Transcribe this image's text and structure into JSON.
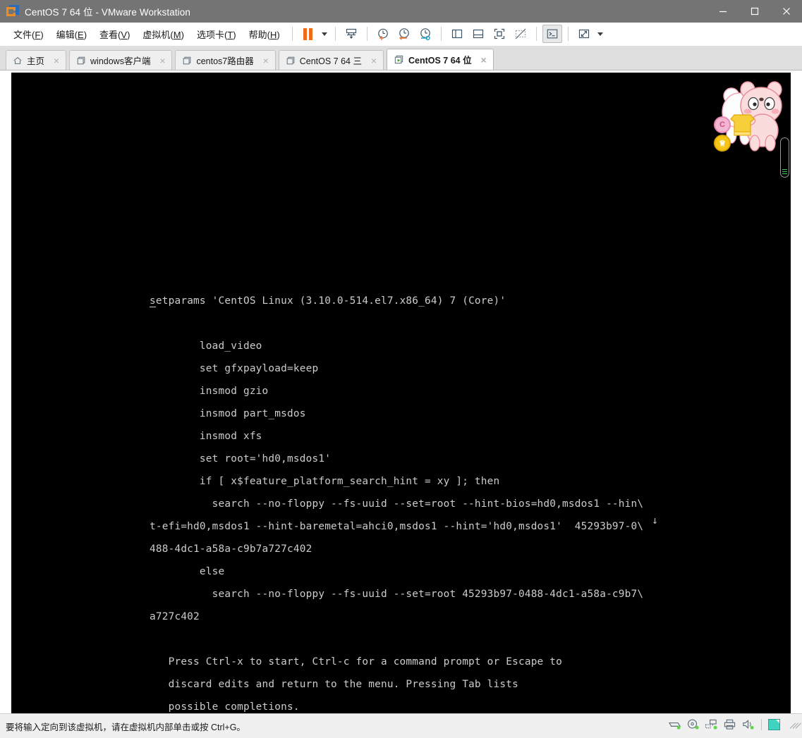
{
  "window": {
    "title": "CentOS 7 64 位 - VMware Workstation",
    "app_icon": "vmware-logo-icon",
    "controls": {
      "minimize": "minimize-icon",
      "maximize": "maximize-icon",
      "close": "close-icon"
    }
  },
  "menu": {
    "items": [
      {
        "label": "文件",
        "mnemonic": "F"
      },
      {
        "label": "编辑",
        "mnemonic": "E"
      },
      {
        "label": "查看",
        "mnemonic": "V"
      },
      {
        "label": "虚拟机",
        "mnemonic": "M"
      },
      {
        "label": "选项卡",
        "mnemonic": "T"
      },
      {
        "label": "帮助",
        "mnemonic": "H"
      }
    ]
  },
  "toolbar": {
    "buttons": [
      {
        "name": "pause-vm-button",
        "icon": "pause-icon"
      },
      {
        "name": "pause-dropdown-button",
        "icon": "chevron-down-icon"
      },
      {
        "name": "send-ctrl-alt-del-button",
        "icon": "keyboard-send-icon"
      },
      {
        "name": "take-snapshot-button",
        "icon": "snapshot-add-icon"
      },
      {
        "name": "revert-snapshot-button",
        "icon": "snapshot-revert-icon"
      },
      {
        "name": "snapshot-manager-button",
        "icon": "snapshot-manager-icon"
      },
      {
        "name": "show-left-pane-button",
        "icon": "pane-left-icon"
      },
      {
        "name": "show-bottom-pane-button",
        "icon": "pane-bottom-icon"
      },
      {
        "name": "full-screen-button",
        "icon": "fullscreen-icon"
      },
      {
        "name": "unity-mode-button",
        "icon": "unity-mode-icon"
      },
      {
        "name": "console-view-button",
        "icon": "console-prompt-icon",
        "pressed": true
      },
      {
        "name": "stretch-view-button",
        "icon": "stretch-arrows-icon"
      },
      {
        "name": "stretch-dropdown-button",
        "icon": "chevron-down-icon"
      }
    ]
  },
  "tabs": [
    {
      "label": "主页",
      "icon": "home-icon",
      "active": false,
      "closable": true
    },
    {
      "label": "windows客户端",
      "icon": "vm-screen-icon",
      "active": false,
      "closable": true
    },
    {
      "label": "centos7路由器",
      "icon": "vm-screen-icon",
      "active": false,
      "closable": true
    },
    {
      "label": "CentOS 7 64 三",
      "icon": "vm-screen-icon",
      "active": false,
      "closable": true
    },
    {
      "label": "CentOS 7 64 位",
      "icon": "vm-screen-running-icon",
      "active": true,
      "closable": true
    }
  ],
  "vm_console": {
    "background_color": "#000000",
    "text_color": "#cccccc",
    "cursor_on_char": "s",
    "lines": [
      "setparams 'CentOS Linux (3.10.0-514.el7.x86_64) 7 (Core)'",
      "",
      "        load_video",
      "        set gfxpayload=keep",
      "        insmod gzio",
      "        insmod part_msdos",
      "        insmod xfs",
      "        set root='hd0,msdos1'",
      "        if [ x$feature_platform_search_hint = xy ]; then",
      "          search --no-floppy --fs-uuid --set=root --hint-bios=hd0,msdos1 --hin\\",
      "t-efi=hd0,msdos1 --hint-baremetal=ahci0,msdos1 --hint='hd0,msdos1'  45293b97-0\\",
      "488-4dc1-a58a-c9b7a727c402",
      "        else",
      "          search --no-floppy --fs-uuid --set=root 45293b97-0488-4dc1-a58a-c9b7\\",
      "a727c402"
    ],
    "help_lines": [
      "   Press Ctrl-x to start, Ctrl-c for a command prompt or Escape to",
      "   discard edits and return to the menu. Pressing Tab lists",
      "   possible completions."
    ],
    "scroll_indicator": "↓"
  },
  "overlay": {
    "mascot": "cartoon-bear-sticker",
    "badge_pink": "C",
    "badge_yellow": "♕"
  },
  "statusbar": {
    "message": "要将输入定向到该虚拟机，请在虚拟机内部单击或按 Ctrl+G。",
    "devices": [
      {
        "name": "hard-disk-device-icon"
      },
      {
        "name": "cd-dvd-device-icon"
      },
      {
        "name": "network-adapter-device-icon"
      },
      {
        "name": "printer-device-icon"
      },
      {
        "name": "sound-card-device-icon"
      }
    ],
    "vm_indicator": "vm-active-indicator",
    "resize_grip": "resize-grip-icon"
  }
}
